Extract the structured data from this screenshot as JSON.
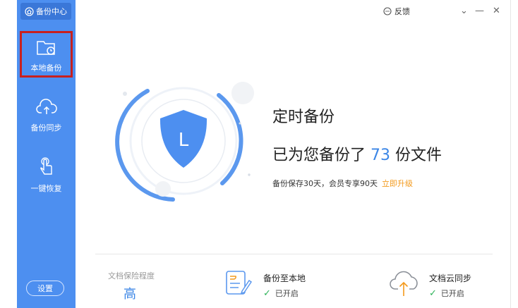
{
  "app": {
    "title": "备份中心"
  },
  "sidebar": {
    "items": [
      {
        "label": "本地备份",
        "icon": "folder-clock-icon",
        "active": true
      },
      {
        "label": "备份同步",
        "icon": "cloud-upload-icon",
        "active": false
      },
      {
        "label": "一键恢复",
        "icon": "hand-pointer-icon",
        "active": false
      }
    ],
    "settings_label": "设置"
  },
  "topbar": {
    "feedback_label": "反馈",
    "feedback_icon": "chat-icon"
  },
  "hero": {
    "title": "定时备份",
    "count_prefix": "已为您备份了",
    "count_value": "73",
    "count_suffix": "份文件",
    "retention_note": "备份保存30天，会员专享90天",
    "upgrade_link": "立即升级",
    "shield_letter": "L"
  },
  "stats": {
    "safety_label": "文档保险程度",
    "safety_level": "高",
    "local_backup": {
      "title": "备份至本地",
      "status": "已开启",
      "icon": "document-edit-icon"
    },
    "cloud_sync": {
      "title": "文档云同步",
      "status": "已开启",
      "icon": "cloud-arrow-icon"
    }
  },
  "colors": {
    "sidebar": "#4d8ff0",
    "accent": "#3b86e6",
    "upgrade": "#f39a1d",
    "ok": "#2eb35a",
    "active_border": "#c8201e"
  }
}
